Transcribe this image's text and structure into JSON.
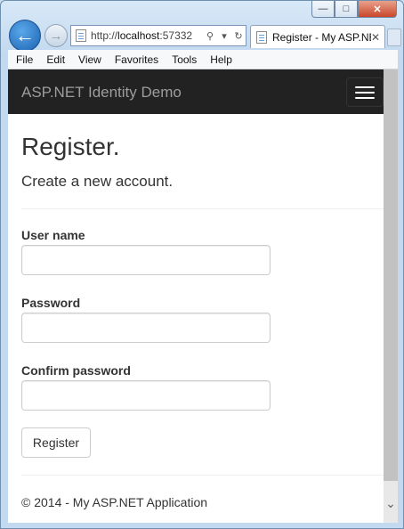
{
  "browser": {
    "address_prefix": "http://",
    "address_host": "localhost",
    "address_rest": ":57332",
    "tab_title": "Register - My ASP.NE...",
    "menu": [
      "File",
      "Edit",
      "View",
      "Favorites",
      "Tools",
      "Help"
    ]
  },
  "navbar": {
    "brand": "ASP.NET Identity Demo"
  },
  "page": {
    "title": "Register.",
    "subtitle": "Create a new account.",
    "fields": [
      {
        "label": "User name",
        "value": ""
      },
      {
        "label": "Password",
        "value": ""
      },
      {
        "label": "Confirm password",
        "value": ""
      }
    ],
    "submit_label": "Register",
    "footer": "© 2014 - My ASP.NET Application"
  }
}
